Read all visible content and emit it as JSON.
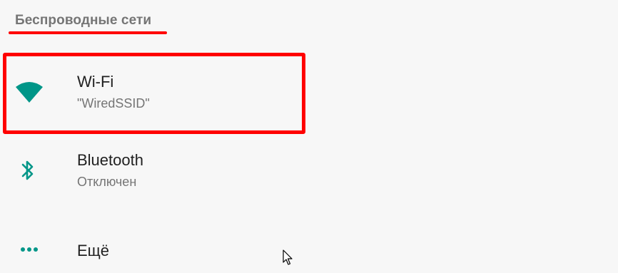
{
  "section": {
    "title": "Беспроводные сети"
  },
  "items": [
    {
      "icon": "wifi-icon",
      "title": "Wi-Fi",
      "summary": "\"WiredSSID\""
    },
    {
      "icon": "bluetooth-icon",
      "title": "Bluetooth",
      "summary": "Отключен"
    },
    {
      "icon": "more-horiz-icon",
      "title": "Ещё"
    }
  ],
  "colors": {
    "accent": "#009688",
    "annotation_red": "#ff0000",
    "title_text": "#212121",
    "secondary_text": "#757575",
    "background": "#f7f7f7"
  }
}
